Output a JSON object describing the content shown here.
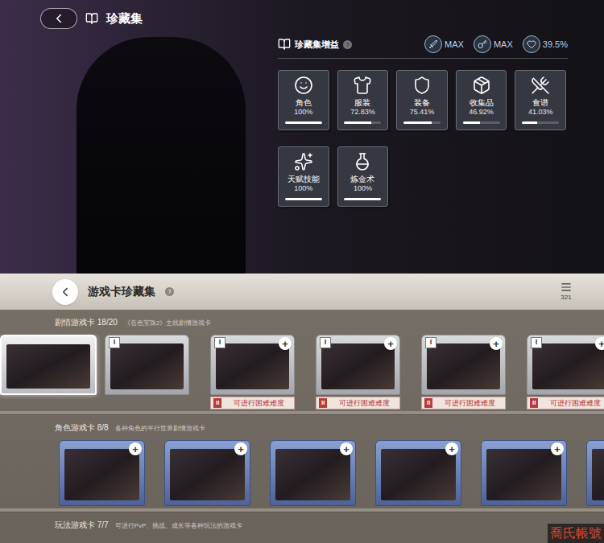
{
  "header": {
    "title": "珍藏集"
  },
  "bonus": {
    "title": "珍藏集增益",
    "help": "?",
    "stats": [
      {
        "value": "MAX"
      },
      {
        "value": "MAX"
      },
      {
        "value": "39.5%"
      }
    ],
    "categories": [
      {
        "label": "角色",
        "value": "100%",
        "level": 1
      },
      {
        "label": "服装",
        "value": "72.83%",
        "level": 0.7283
      },
      {
        "label": "装备",
        "value": "75.41%",
        "level": 0.7541
      },
      {
        "label": "收集品",
        "value": "46.92%",
        "level": 0.4692
      },
      {
        "label": "食谱",
        "value": "41.03%",
        "level": 0.4103
      },
      {
        "label": "天赋技能",
        "value": "100%",
        "level": 1
      },
      {
        "label": "炼金术",
        "value": "100%",
        "level": 1
      }
    ]
  },
  "collection": {
    "title": "游戏卡珍藏集",
    "help": "?",
    "count": "321",
    "add_glyph": "+",
    "sections": [
      {
        "title": "剧情游戏卡 18/20",
        "subtitle": "《苍色宝珠2》主线剧情游戏卡",
        "kind": "story",
        "cards": [
          {
            "selected": true,
            "tier": "",
            "addable": false
          },
          {
            "selected": false,
            "tier": "I",
            "addable": false
          },
          {
            "selected": false,
            "tier": "I",
            "addable": true,
            "hard": {
              "tier": "II",
              "label": "可进行困难难度"
            }
          },
          {
            "selected": false,
            "tier": "I",
            "addable": true,
            "hard": {
              "tier": "II",
              "label": "可进行困难难度"
            }
          },
          {
            "selected": false,
            "tier": "I",
            "addable": true,
            "hard": {
              "tier": "II",
              "label": "可进行困难难度"
            }
          },
          {
            "selected": false,
            "tier": "I",
            "addable": true,
            "hard": {
              "tier": "II",
              "label": "可进行困难难度"
            }
          }
        ]
      },
      {
        "title": "角色游戏卡 8/8",
        "subtitle": "各种角色的平行世界剧情游戏卡",
        "kind": "character",
        "cards": [
          {
            "selected": false,
            "tier": "",
            "addable": true
          },
          {
            "selected": false,
            "tier": "",
            "addable": true
          },
          {
            "selected": false,
            "tier": "",
            "addable": true
          },
          {
            "selected": false,
            "tier": "",
            "addable": true
          },
          {
            "selected": false,
            "tier": "",
            "addable": true
          },
          {
            "selected": false,
            "tier": "",
            "addable": true
          }
        ]
      },
      {
        "title": "玩法游戏卡 7/7",
        "subtitle": "可进行PvP、挑战、成长等各种玩法的游戏卡",
        "kind": "mode",
        "cards": []
      }
    ]
  },
  "watermark": "喬氏帳號"
}
